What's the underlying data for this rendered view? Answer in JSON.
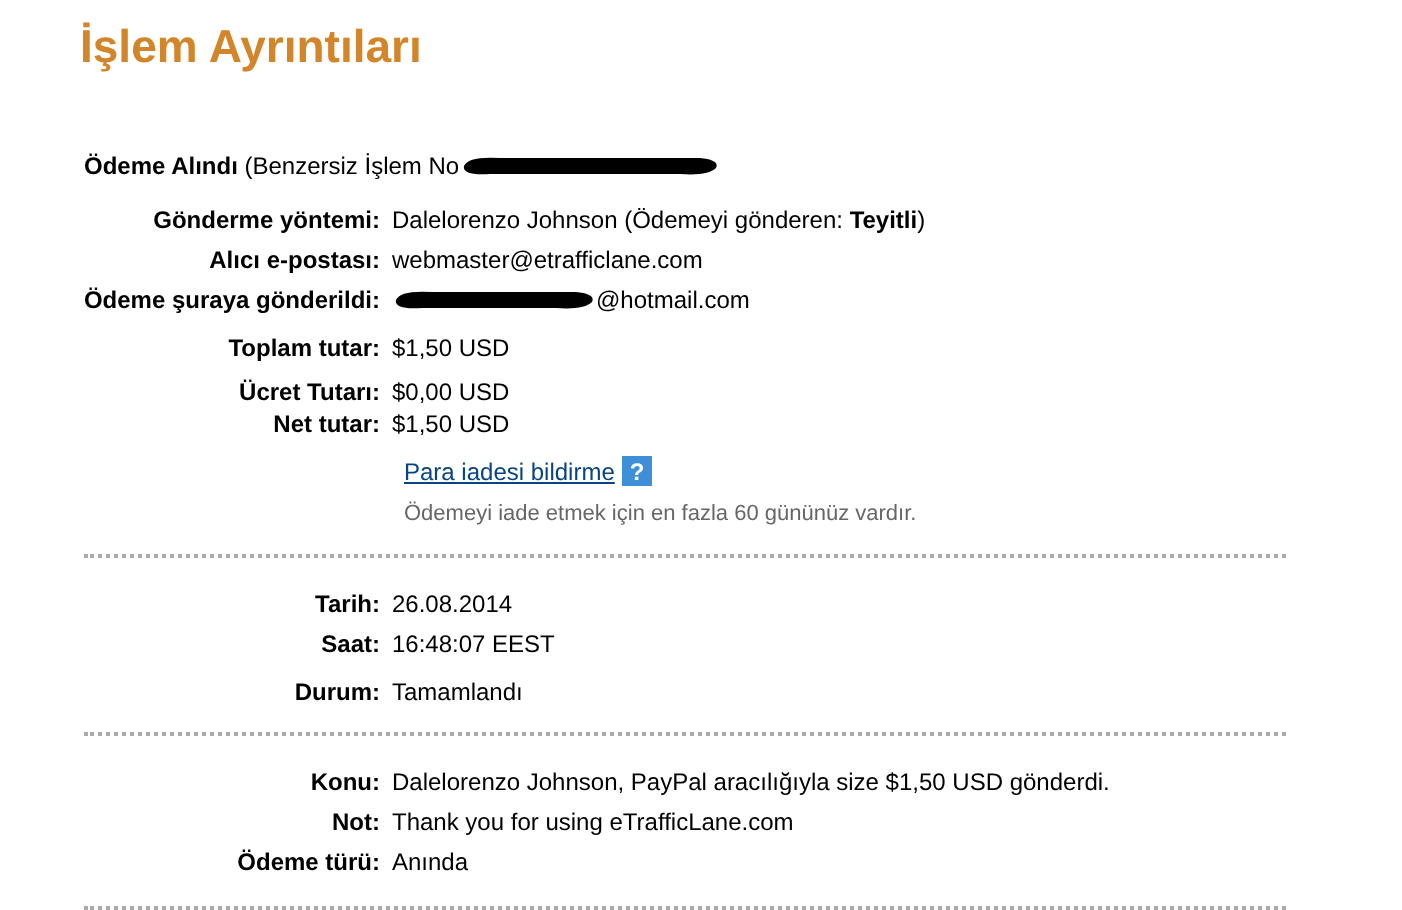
{
  "title": "İşlem Ayrıntıları",
  "header": {
    "text": "**Ödeme Alındı** (Benzersiz İşlem No",
    "redacted": true
  },
  "sections": [
    {
      "groups": [
        [
          {
            "label": "Gönderme yöntemi:",
            "value": "Dalelorenzo Johnson (Ödemeyi gönderen: **Teyitli**)",
            "kind": "text"
          },
          {
            "label": "Alıcı e-postası:",
            "value": "webmaster@etrafficlane.com",
            "kind": "text"
          },
          {
            "label": "Ödeme şuraya gönderildi:",
            "value": "@hotmail.com",
            "kind": "redacted"
          }
        ],
        [
          {
            "label": "Toplam tutar:",
            "value": "$1,50 USD",
            "kind": "text"
          }
        ],
        [
          {
            "label": "Ücret Tutarı:",
            "value": "$0,00 USD",
            "kind": "text"
          },
          {
            "label": "Net tutar:",
            "value": "$1,50 USD",
            "kind": "text"
          },
          {
            "value": "Para iadesi bildirme",
            "help": "?",
            "note": "Ödemeyi iade etmek için en fazla 60 gününüz vardır.",
            "kind": "link"
          }
        ]
      ]
    },
    {
      "groups": [
        [
          {
            "label": "Tarih:",
            "value": "26.08.2014",
            "kind": "text"
          },
          {
            "label": "Saat:",
            "value": "16:48:07 EEST",
            "kind": "text"
          }
        ],
        [
          {
            "label": "Durum:",
            "value": "Tamamlandı",
            "kind": "text"
          }
        ]
      ]
    },
    {
      "groups": [
        [
          {
            "label": "Konu:",
            "value": "Dalelorenzo Johnson, PayPal aracılığıyla size $1,50 USD gönderdi.",
            "kind": "text"
          },
          {
            "label": "Not:",
            "value": "Thank you for using eTrafficLane.com",
            "kind": "text"
          },
          {
            "label": "Ödeme türü:",
            "value": "Anında",
            "kind": "text"
          }
        ]
      ]
    }
  ]
}
